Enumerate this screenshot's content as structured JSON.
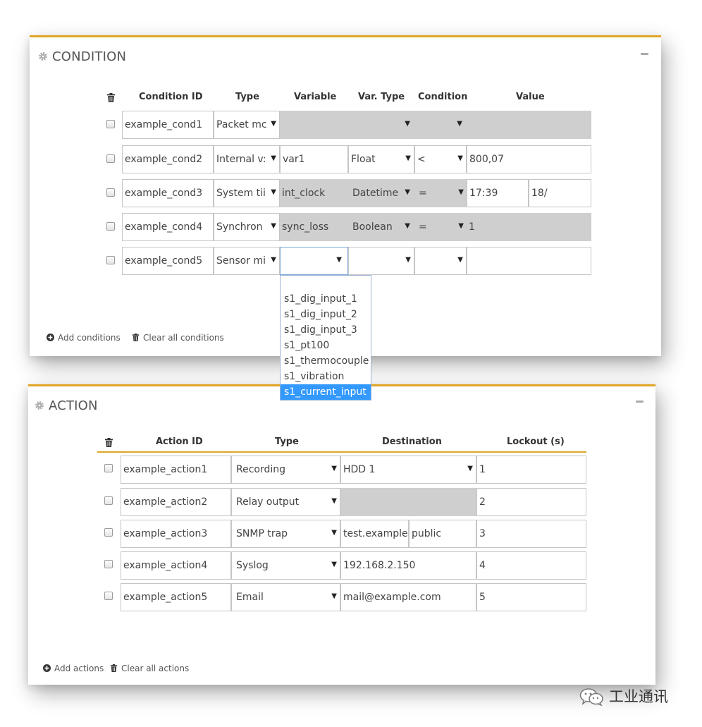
{
  "condition_panel": {
    "title": "CONDITION",
    "headers": {
      "id": "Condition ID",
      "type": "Type",
      "variable": "Variable",
      "var_type": "Var. Type",
      "condition": "Condition",
      "value": "Value"
    },
    "rows": [
      {
        "id": "example_cond1",
        "type": "Packet mc",
        "variable": "",
        "var_type": "",
        "condition": "",
        "value": "",
        "value2": ""
      },
      {
        "id": "example_cond2",
        "type": "Internal v:",
        "variable": "var1",
        "var_type": "Float",
        "condition": "<",
        "value": "800,07",
        "value2": ""
      },
      {
        "id": "example_cond3",
        "type": "System tii",
        "variable": "int_clock",
        "var_type": "Datetime",
        "condition": "=",
        "value": "17:39",
        "value2": "18/"
      },
      {
        "id": "example_cond4",
        "type": "Synchron",
        "variable": "sync_loss",
        "var_type": "Boolean",
        "condition": "=",
        "value": "1",
        "value2": ""
      },
      {
        "id": "example_cond5",
        "type": "Sensor mi",
        "variable": "",
        "var_type": "",
        "condition": "",
        "value": "",
        "value2": ""
      }
    ],
    "variable_dropdown": {
      "options": [
        "s1_dig_input_1",
        "s1_dig_input_2",
        "s1_dig_input_3",
        "s1_pt100",
        "s1_thermocouple",
        "s1_vibration",
        "s1_current_input"
      ],
      "highlighted": "s1_current_input"
    },
    "add_label": "Add conditions",
    "clear_label": "Clear all conditions"
  },
  "action_panel": {
    "title": "ACTION",
    "headers": {
      "id": "Action ID",
      "type": "Type",
      "destination": "Destination",
      "lockout": "Lockout (s)"
    },
    "rows": [
      {
        "id": "example_action1",
        "type": "Recording",
        "destination": "HDD 1",
        "destination2": "",
        "lockout": "1"
      },
      {
        "id": "example_action2",
        "type": "Relay output",
        "destination": "",
        "destination2": "",
        "lockout": "2"
      },
      {
        "id": "example_action3",
        "type": "SNMP trap",
        "destination": "test.example",
        "destination2": "public",
        "lockout": "3"
      },
      {
        "id": "example_action4",
        "type": "Syslog",
        "destination": "192.168.2.150",
        "destination2": "",
        "lockout": "4"
      },
      {
        "id": "example_action5",
        "type": "Email",
        "destination": "mail@example.com",
        "destination2": "",
        "lockout": "5"
      }
    ],
    "add_label": "Add actions",
    "clear_label": "Clear all actions"
  },
  "watermark": {
    "text": "工业通讯"
  },
  "colors": {
    "accent": "#e0a526",
    "disabled_fill": "#cfcfcf",
    "highlight": "#3399ff"
  }
}
